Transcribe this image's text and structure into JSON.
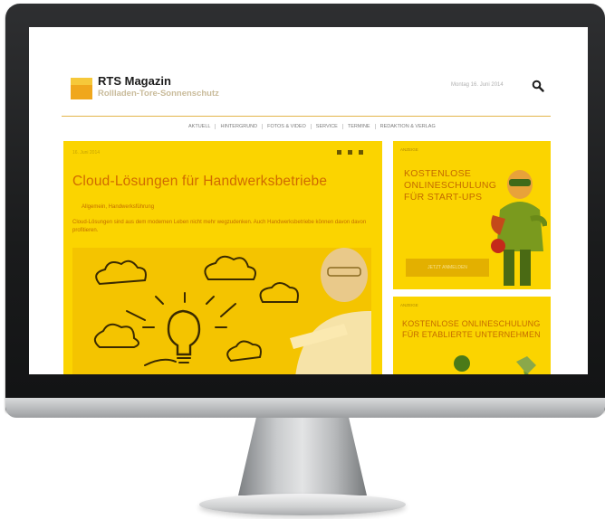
{
  "site": {
    "name": "RTS Magazin",
    "tagline": "Rollladen-Tore-Sonnenschutz",
    "date": "Montag 16. Juni 2014"
  },
  "nav": {
    "items": [
      "AKTUELL",
      "HINTERGRUND",
      "FOTOS & VIDEO",
      "SERVICE",
      "TERMINE",
      "REDAKTION & VERLAG"
    ]
  },
  "article": {
    "date": "16. Juni 2014",
    "title": "Cloud-Lösungen für Handwerksbetriebe",
    "category": "Allgemein, Handwerksführung",
    "teaser": "Cloud-Lösungen sind aus dem modernen Leben nicht mehr wegzudenken. Auch Handwerksbetriebe können davon davon profitieren."
  },
  "sidebar": {
    "ad1": {
      "tag": "ANZEIGE",
      "text": "KOSTENLOSE ONLINESCHULUNG FÜR START-UPS",
      "button": "JETZT ANMELDEN"
    },
    "ad2": {
      "tag": "ANZEIGE",
      "text": "KOSTENLOSE ONLINESCHULUNG FÜR ETABLIERTE UNTERNEHMEN"
    }
  },
  "colors": {
    "accent_yellow": "#fbd400",
    "accent_orange": "#d06a00",
    "logo_orange": "#f0a71c"
  }
}
